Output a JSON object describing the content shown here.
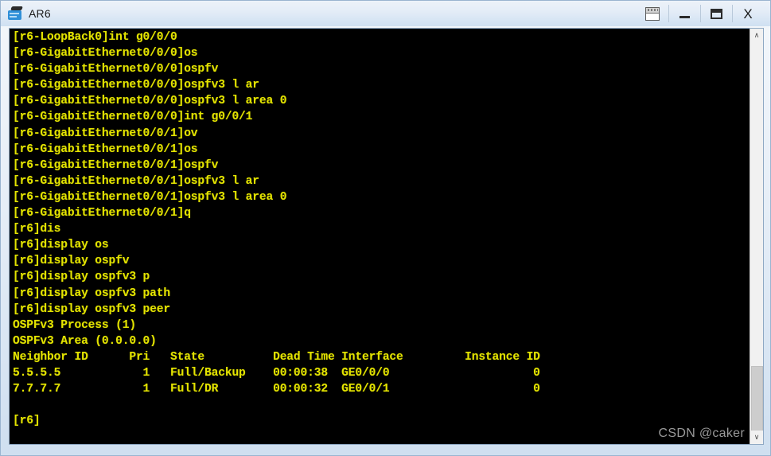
{
  "window": {
    "title": "AR6",
    "app_icon": "router-icon",
    "buttons": [
      {
        "name": "restore-window-button",
        "icon": "restore-icon",
        "label": ""
      },
      {
        "name": "minimize-button",
        "icon": "minimize-icon",
        "label": ""
      },
      {
        "name": "maximize-button",
        "icon": "maximize-icon",
        "label": ""
      },
      {
        "name": "close-button",
        "icon": "close-icon",
        "label": "X"
      }
    ]
  },
  "terminal": {
    "foreground_color": "#e3e300",
    "background_color": "#000000",
    "content": "[r6-LoopBack0]int g0/0/0\n[r6-GigabitEthernet0/0/0]os\n[r6-GigabitEthernet0/0/0]ospfv\n[r6-GigabitEthernet0/0/0]ospfv3 l ar\n[r6-GigabitEthernet0/0/0]ospfv3 l area 0\n[r6-GigabitEthernet0/0/0]int g0/0/1\n[r6-GigabitEthernet0/0/1]ov\n[r6-GigabitEthernet0/0/1]os\n[r6-GigabitEthernet0/0/1]ospfv\n[r6-GigabitEthernet0/0/1]ospfv3 l ar\n[r6-GigabitEthernet0/0/1]ospfv3 l area 0\n[r6-GigabitEthernet0/0/1]q\n[r6]dis\n[r6]display os\n[r6]display ospfv\n[r6]display ospfv3 p\n[r6]display ospfv3 path\n[r6]display ospfv3 peer\nOSPFv3 Process (1)\nOSPFv3 Area (0.0.0.0)\nNeighbor ID      Pri   State          Dead Time Interface         Instance ID\n5.5.5.5            1   Full/Backup    00:00:38  GE0/0/0                     0\n7.7.7.7            1   Full/DR        00:00:32  GE0/0/1                     0\n\n[r6]",
    "lines": [
      "[r6-LoopBack0]int g0/0/0",
      "[r6-GigabitEthernet0/0/0]os",
      "[r6-GigabitEthernet0/0/0]ospfv",
      "[r6-GigabitEthernet0/0/0]ospfv3 l ar",
      "[r6-GigabitEthernet0/0/0]ospfv3 l area 0",
      "[r6-GigabitEthernet0/0/0]int g0/0/1",
      "[r6-GigabitEthernet0/0/1]ov",
      "[r6-GigabitEthernet0/0/1]os",
      "[r6-GigabitEthernet0/0/1]ospfv",
      "[r6-GigabitEthernet0/0/1]ospfv3 l ar",
      "[r6-GigabitEthernet0/0/1]ospfv3 l area 0",
      "[r6-GigabitEthernet0/0/1]q",
      "[r6]dis",
      "[r6]display os",
      "[r6]display ospfv",
      "[r6]display ospfv3 p",
      "[r6]display ospfv3 path",
      "[r6]display ospfv3 peer",
      "OSPFv3 Process (1)",
      "OSPFv3 Area (0.0.0.0)",
      "Neighbor ID      Pri   State          Dead Time Interface         Instance ID",
      "5.5.5.5            1   Full/Backup    00:00:38  GE0/0/0                     0",
      "7.7.7.7            1   Full/DR        00:00:32  GE0/0/1                     0",
      "",
      "[r6]"
    ],
    "ospf_output": {
      "process": "OSPFv3 Process (1)",
      "area": "OSPFv3 Area (0.0.0.0)",
      "columns": [
        "Neighbor ID",
        "Pri",
        "State",
        "Dead Time",
        "Interface",
        "Instance ID"
      ],
      "rows": [
        [
          "5.5.5.5",
          "1",
          "Full/Backup",
          "00:00:38",
          "GE0/0/0",
          "0"
        ],
        [
          "7.7.7.7",
          "1",
          "Full/DR",
          "00:00:32",
          "GE0/0/1",
          "0"
        ]
      ]
    },
    "prompt": "[r6]"
  },
  "scrollbar": {
    "up_arrow": "∧",
    "down_arrow": "∨"
  },
  "watermark": {
    "text": "CSDN @caker"
  }
}
